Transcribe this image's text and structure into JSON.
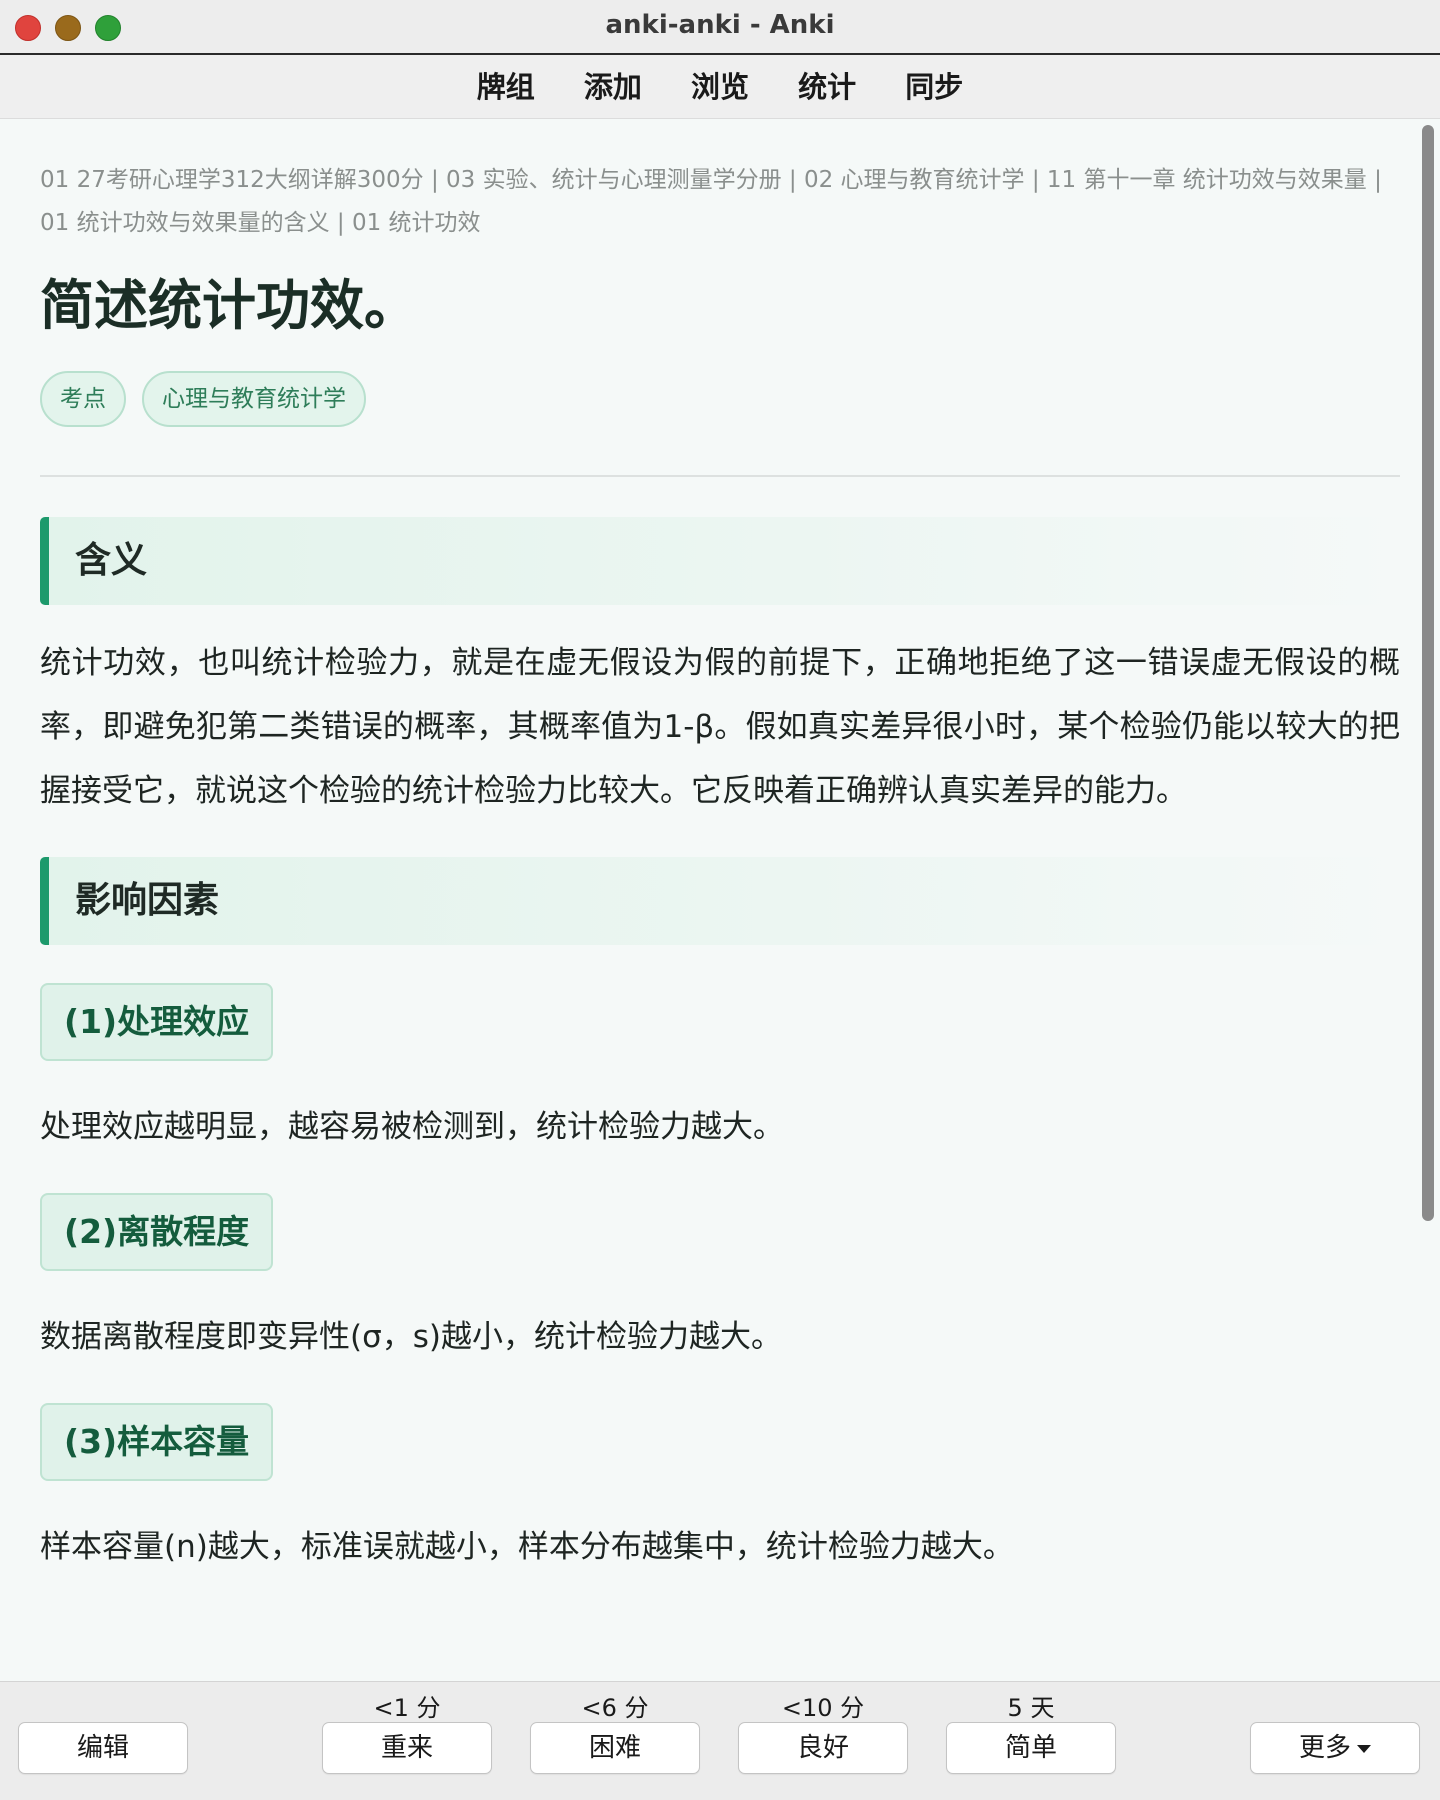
{
  "window": {
    "title": "anki-anki - Anki"
  },
  "nav": {
    "decks": "牌组",
    "add": "添加",
    "browse": "浏览",
    "stats": "统计",
    "sync": "同步"
  },
  "card": {
    "breadcrumb": "01 27考研心理学312大纲详解300分 | 03 实验、统计与心理测量学分册 | 02 心理与教育统计学 | 11 第十一章 统计功效与效果量 | 01 统计功效与效果量的含义 | 01 统计功效",
    "title": "简述统计功效。",
    "tags": [
      "考点",
      "心理与教育统计学"
    ],
    "section1": {
      "heading": "含义",
      "text": "统计功效，也叫统计检验力，就是在虚无假设为假的前提下，正确地拒绝了这一错误虚无假设的概率，即避免犯第二类错误的概率，其概率值为1-β。假如真实差异很小时，某个检验仍能以较大的把握接受它，就说这个检验的统计检验力比较大。它反映着正确辨认真实差异的能力。"
    },
    "section2": {
      "heading": "影响因素",
      "factors": [
        {
          "label": "(1)处理效应",
          "text": "处理效应越明显，越容易被检测到，统计检验力越大。"
        },
        {
          "label": "(2)离散程度",
          "text": "数据离散程度即变异性(σ，s)越小，统计检验力越大。"
        },
        {
          "label": "(3)样本容量",
          "text": "样本容量(n)越大，标准误就越小，样本分布越集中，统计检验力越大。"
        }
      ]
    }
  },
  "bottom": {
    "edit": "编辑",
    "again": {
      "label": "重来",
      "interval": "<1 分"
    },
    "hard": {
      "label": "困难",
      "interval": "<6 分"
    },
    "good": {
      "label": "良好",
      "interval": "<10 分"
    },
    "easy": {
      "label": "简单",
      "interval": "5 天"
    },
    "more": "更多"
  },
  "icons": {
    "close": "close-icon",
    "minimize": "minimize-icon",
    "maximize": "maximize-icon",
    "more_caret": "chevron-down-icon"
  },
  "colors": {
    "accent": "#1d9a6c",
    "tag_bg": "#e3f4ec",
    "tag_text": "#2e7d59",
    "sub_head_text": "#145c3d",
    "close": "#e0443e",
    "minimize": "#9a6a1c",
    "maximize": "#2fa03a"
  }
}
